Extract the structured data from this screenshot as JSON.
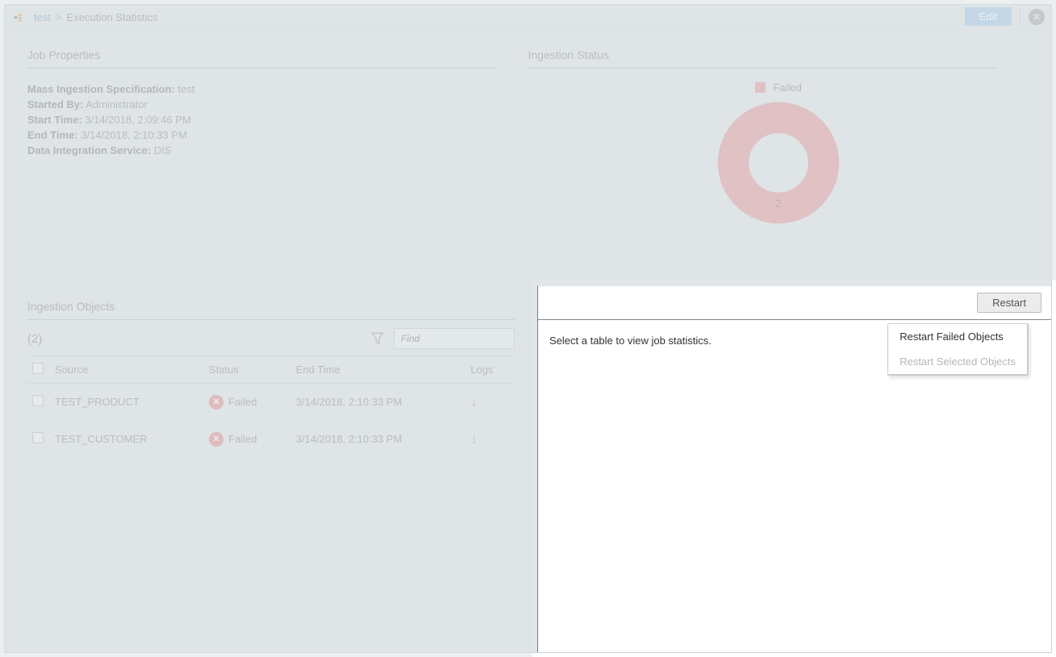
{
  "breadcrumb": {
    "link": "test",
    "separator": ">",
    "current": "Execution Statistics"
  },
  "header": {
    "edit_label": "Edit"
  },
  "job_properties": {
    "title": "Job Properties",
    "spec_label": "Mass Ingestion Specification:",
    "spec_value": "test",
    "started_by_label": "Started By:",
    "started_by_value": "Administrator",
    "start_time_label": "Start Time:",
    "start_time_value": "3/14/2018, 2:09:46 PM",
    "end_time_label": "End Time:",
    "end_time_value": "3/14/2018, 2:10:33 PM",
    "dis_label": "Data Integration Service:",
    "dis_value": "DIS"
  },
  "ingestion_status": {
    "title": "Ingestion Status",
    "legend_label": "Failed",
    "legend_color": "#e59a9d"
  },
  "chart_data": {
    "type": "pie",
    "title": "Ingestion Status",
    "series": [
      {
        "name": "Failed",
        "value": 2,
        "color": "#e59a9d"
      }
    ],
    "total": 2
  },
  "ingestion_objects": {
    "title": "Ingestion Objects",
    "count_display": "(2)",
    "find_placeholder": "Find",
    "columns": {
      "source": "Source",
      "status": "Status",
      "end_time": "End Time",
      "logs": "Logs"
    },
    "rows": [
      {
        "source": "TEST_PRODUCT",
        "status": "Failed",
        "end_time": "3/14/2018, 2:10:33 PM"
      },
      {
        "source": "TEST_CUSTOMER",
        "status": "Failed",
        "end_time": "3/14/2018, 2:10:33 PM"
      }
    ]
  },
  "detail": {
    "restart_label": "Restart",
    "placeholder_msg": "Select a table to view job statistics."
  },
  "dropdown": {
    "restart_failed": "Restart Failed Objects",
    "restart_selected": "Restart Selected Objects"
  }
}
